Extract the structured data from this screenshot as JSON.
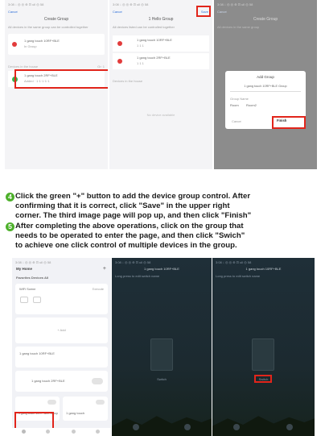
{
  "top": {
    "p1": {
      "status": "3:08 ↓ ◎   ◎ ⊕ ⊡ ull ◎ 58",
      "cancel": "Cancel",
      "title": "Create Group",
      "hint": "All devices in the same group can be controlled together",
      "device1": "1 gang touch 10RF+BLE",
      "device1_sub": "In Group",
      "section": "Devices in the house",
      "section_count": "Gr: 1",
      "device2": "1 gang touch 2RF+BLE",
      "device2_sub": "Added · 1·1·1·1·1",
      "add_icon": "plus-icon"
    },
    "p2": {
      "status": "3:08 ↓ ◎   ◎ ⊕ ⊡ ull ◎ 58",
      "cancel": "Cancel",
      "title": "1 Hello Group",
      "save": "Save",
      "hint": "All devices listed can be controlled together",
      "device1": "1 gang touch 10RF+BLE",
      "device1_sub": "1 1 1",
      "device2": "1 gang touch 2RF+BLE",
      "device2_sub": "1 1 1",
      "section": "Devices in the house",
      "empty": "No device available"
    },
    "p3": {
      "status": "3:08 ↓ ◎   ◎ ⊕ ⊡ ull ◎ 58",
      "cancel": "Cancel",
      "title": "Create Group",
      "hint": "All devices in the same group",
      "dialog_title": "Add Group",
      "dialog_input": "1 gang touch 10RF+BLE Group",
      "dialog_label": "Group Name",
      "dialog_opt1": "Room",
      "dialog_opt2": "Room2",
      "dialog_cancel": "Cancel",
      "dialog_finish": "Finish"
    }
  },
  "steps": {
    "s4": {
      "num": "4",
      "line1": "Click the green \"+\" button to add the device group control. After",
      "line2": "confirming that it is correct, click \"Save\" in the upper right",
      "line3": "corner. The third image page will pop up, and then click \"Finish\""
    },
    "s5": {
      "num": "5",
      "line1": "After completing the above operations, click on the group that",
      "line2": "needs to be operated to enter the page, and then click \"Swich\"",
      "line3": "to achieve one click control of multiple devices in the group."
    }
  },
  "bottom": {
    "p1": {
      "status": "3:08 ↓ ◎   ◎ ⊕ ⊡ ull ◎ 58",
      "home": "My Home",
      "tabs": "Favorites   Devices   All",
      "card1": "WiFi Scene",
      "card1_sub": "Execute",
      "add_label": "+ Add",
      "dev1": "1 gang touch 10RF+BLE",
      "dev2": "1 gang touch 2RF+BLE",
      "dev3": "1 gang touch",
      "dev3b": "1 gang touch",
      "group_label": "1 gang touch 10RF+BLE Group",
      "nav": [
        "Home",
        "Scene",
        "Smart",
        "Me"
      ]
    },
    "p2": {
      "status": "3:08 ↓ ◎   ◎ ⊕ ⊡ ull ◎ 58",
      "title": "1 gang touch 10RF+BLE",
      "sub": "Long press to edit switch name",
      "switch_label": "Switch"
    },
    "p3": {
      "status": "3:08 ↓ ◎   ◎ ⊕ ⊡ ull ◎ 58",
      "title": "1 gang touch 10RF+BLE",
      "sub": "Long press to edit switch name",
      "switch_label": "Switch"
    }
  }
}
